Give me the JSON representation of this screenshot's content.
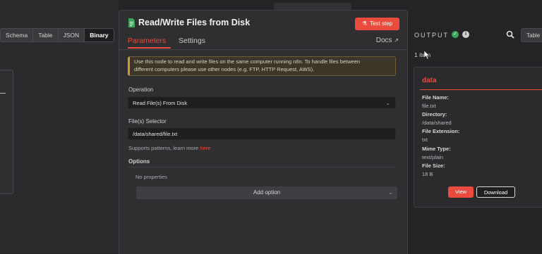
{
  "left_panel": {
    "tabs": [
      "Schema",
      "Table",
      "JSON",
      "Binary"
    ],
    "active_tab": "Binary"
  },
  "modal": {
    "title": "Read/Write Files from Disk",
    "test_button": "Test step",
    "tabs": {
      "parameters": "Parameters",
      "settings": "Settings"
    },
    "docs_link": "Docs",
    "notice_line1": "Use this node to read and write files on the same computer running n8n. To handle files between",
    "notice_line2": "different computers please use other nodes (e.g. FTP, HTTP Request, AWS).",
    "operation_label": "Operation",
    "operation_value": "Read File(s) From Disk",
    "selector_label": "File(s) Selector",
    "selector_value": "/data/shared/file.txt",
    "hint_text": "Supports patterns, learn more ",
    "hint_link": "here",
    "options_title": "Options",
    "no_properties": "No properties",
    "add_option": "Add option"
  },
  "output": {
    "title": "OUTPUT",
    "item_count": "1 item",
    "table_tab": "Table",
    "card": {
      "title": "data",
      "fields": [
        {
          "key": "File Name:",
          "value": "file.txt"
        },
        {
          "key": "Directory:",
          "value": "/data/shared"
        },
        {
          "key": "File Extension:",
          "value": "txt"
        },
        {
          "key": "Mime Type:",
          "value": "text/plain"
        },
        {
          "key": "File Size:",
          "value": "18 B"
        }
      ],
      "view_button": "View",
      "download_button": "Download"
    }
  },
  "colors": {
    "accent": "#ea4b3c",
    "success": "#3aa55d",
    "warning_border": "#c79a3a"
  }
}
